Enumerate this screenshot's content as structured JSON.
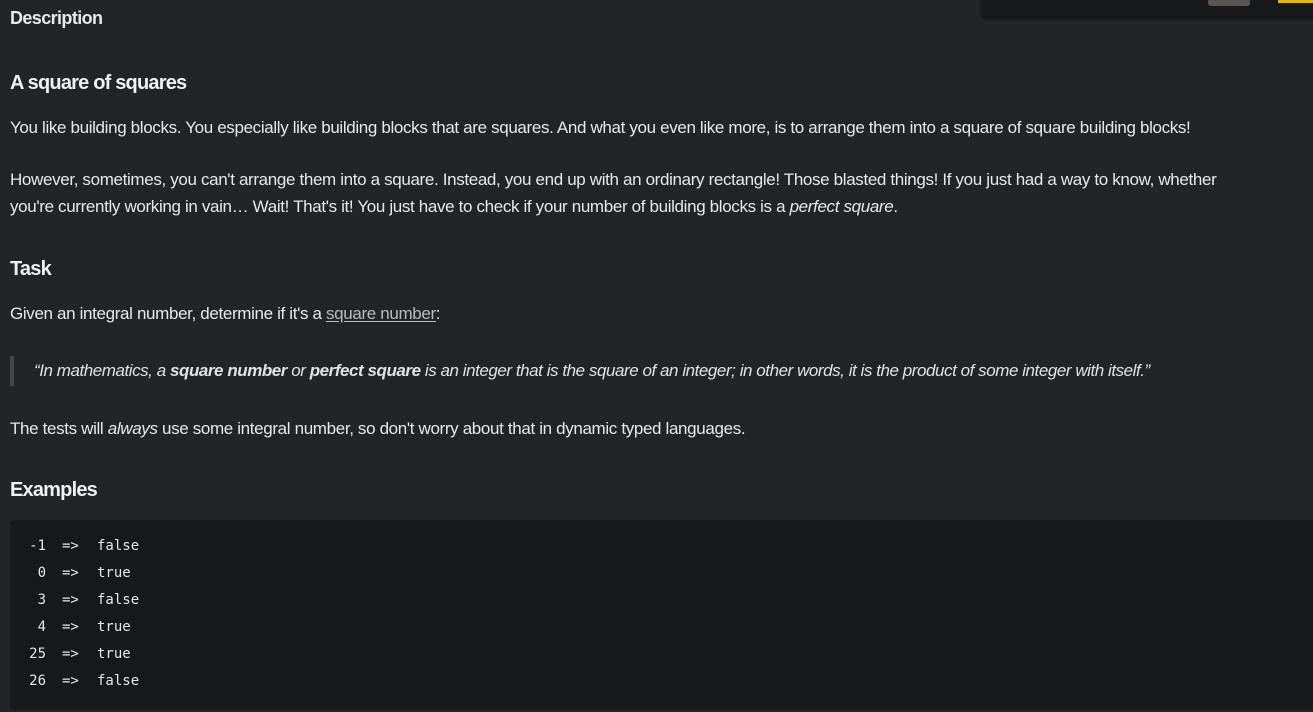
{
  "header": {
    "section_label": "Description"
  },
  "kata": {
    "title": "A square of squares",
    "intro": "You like building blocks. You especially like building blocks that are squares. And what you even like more, is to arrange them into a square of square building blocks!",
    "para2_line1": "However, sometimes, you can't arrange them into a square. Instead, you end up with an ordinary rectangle! Those blasted things! If you just had a way to know, whether",
    "para2_line2_prefix": "you're currently working in vain… Wait! That's it! You just have to check if your number of building blocks is a ",
    "para2_emphasis": "perfect square",
    "para2_suffix": "."
  },
  "task": {
    "heading": "Task",
    "text_prefix": "Given an integral number, determine if it's a ",
    "link_label": "square number",
    "text_suffix": ":",
    "quote": {
      "open": "“In mathematics, a ",
      "bold1": "square number",
      "mid": " or ",
      "bold2": "perfect square",
      "rest": " is an integer that is the square of an integer; in other words, it is the product of some integer with itself.”"
    },
    "note_prefix": "The tests will ",
    "note_emphasis": "always",
    "note_suffix": " use some integral number, so don't worry about that in dynamic typed languages."
  },
  "examples": {
    "heading": "Examples",
    "arrow": "=>",
    "rows": [
      {
        "input": "-1",
        "output": "false"
      },
      {
        "input": "0",
        "output": "true"
      },
      {
        "input": "3",
        "output": "false"
      },
      {
        "input": "4",
        "output": "true"
      },
      {
        "input": "25",
        "output": "true"
      },
      {
        "input": "26",
        "output": "false"
      }
    ]
  }
}
